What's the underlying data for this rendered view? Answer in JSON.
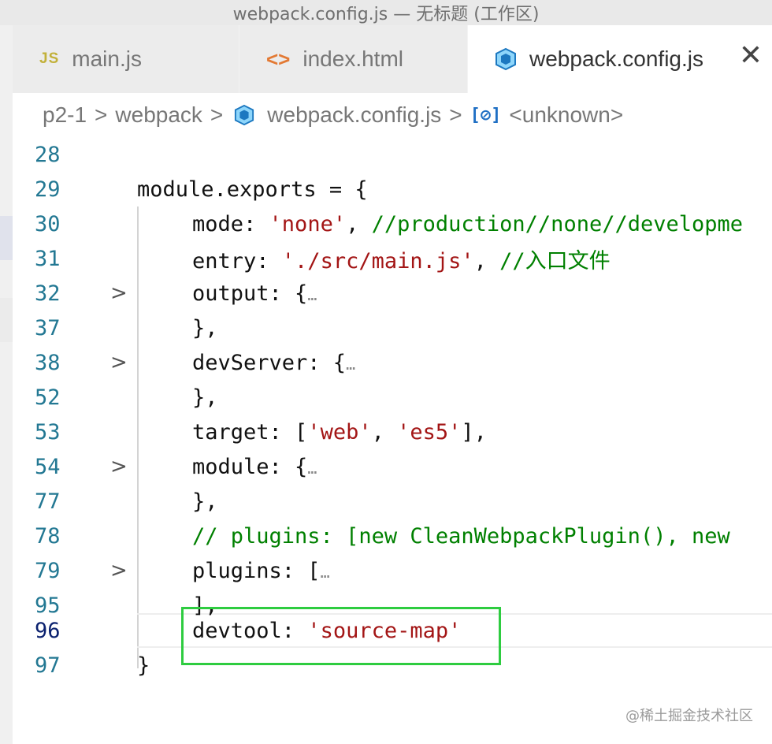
{
  "window": {
    "title": "webpack.config.js — 无标题 (工作区)"
  },
  "tabs": [
    {
      "icon": "js-file-icon",
      "icon_text": "JS",
      "label": "main.js",
      "active": false
    },
    {
      "icon": "html-file-icon",
      "icon_text": "<>",
      "label": "index.html",
      "active": false
    },
    {
      "icon": "webpack-cube-icon",
      "label": "webpack.config.js",
      "active": true,
      "close": "✕"
    }
  ],
  "breadcrumb": {
    "items": [
      "p2-1",
      "webpack",
      "webpack.config.js",
      "<unknown>"
    ],
    "separator": ">",
    "symbol_icon_text": "[⊘]"
  },
  "editor": {
    "lines": [
      {
        "number": "28",
        "fold": "",
        "text": ""
      },
      {
        "number": "29",
        "fold": "",
        "text": "module.exports = {"
      },
      {
        "number": "30",
        "fold": "",
        "key": "mode: ",
        "string": "'none'",
        "after": ", ",
        "comment": "//production//none//developme"
      },
      {
        "number": "31",
        "fold": "",
        "key": "entry: ",
        "string": "'./src/main.js'",
        "after": ", ",
        "comment": "//入口文件"
      },
      {
        "number": "32",
        "fold": ">",
        "text": "output: {",
        "ellipsis": "…"
      },
      {
        "number": "37",
        "fold": "",
        "text": "},"
      },
      {
        "number": "38",
        "fold": ">",
        "text": "devServer: {",
        "ellipsis": "…"
      },
      {
        "number": "52",
        "fold": "",
        "text": "},"
      },
      {
        "number": "53",
        "fold": "",
        "key": "target: [",
        "string": "'web'",
        "after": ", ",
        "string2": "'es5'",
        "after2": "],"
      },
      {
        "number": "54",
        "fold": ">",
        "text": "module: {",
        "ellipsis": "…"
      },
      {
        "number": "77",
        "fold": "",
        "text": "},"
      },
      {
        "number": "78",
        "fold": "",
        "comment": "// plugins: [new CleanWebpackPlugin(), new"
      },
      {
        "number": "79",
        "fold": ">",
        "text": "plugins: [",
        "ellipsis": "…"
      },
      {
        "number": "95",
        "fold": "",
        "text": "],"
      },
      {
        "number": "96",
        "fold": "",
        "key": "devtool: ",
        "string": "'source-map'"
      },
      {
        "number": "97",
        "fold": "",
        "text": "}"
      }
    ]
  },
  "watermark": "@稀土掘金技术社区",
  "colors": {
    "line_number": "#237893",
    "string": "#a31515",
    "comment": "#008000",
    "highlight_box": "#2ecc40"
  }
}
